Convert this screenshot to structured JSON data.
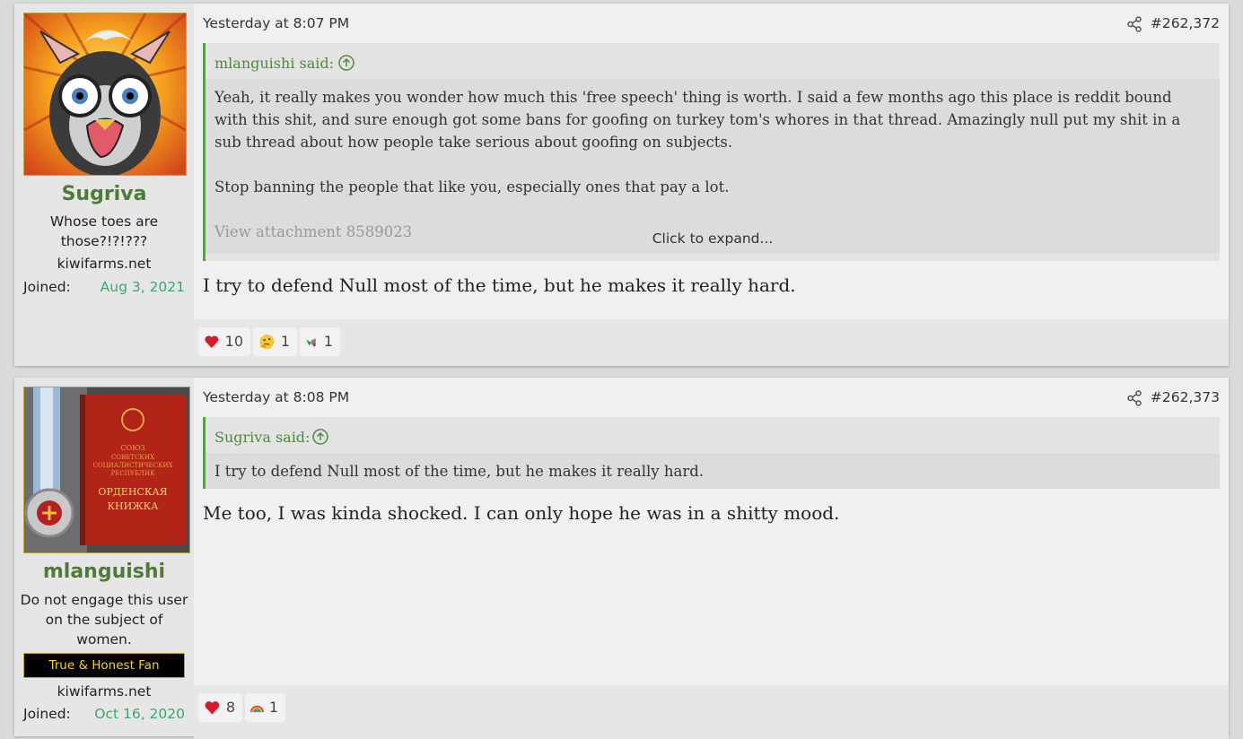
{
  "posts": [
    {
      "username": "Sugriva",
      "user_title": "Whose toes are those?!?!???",
      "site": "kiwifarms.net",
      "joined_label": "Joined:",
      "joined_date": "Aug 3, 2021",
      "date": "Yesterday at 8:07 PM",
      "post_number": "#262,372",
      "quote": {
        "author": "mlanguishi said:",
        "paragraphs": [
          "Yeah, it really makes you wonder how much this 'free speech' thing is worth. I said a few months ago this place is reddit bound with this shit, and sure enough got some bans for goofing on turkey tom's whores in that thread. Amazingly null put my shit in a sub thread about how people take serious about goofing on subjects.",
          "Stop banning the people that like you, especially ones that pay a lot.",
          "View attachment 8589023"
        ],
        "expand_label": "Click to expand..."
      },
      "message": "I try to defend Null most of the time, but he makes it really hard.",
      "reactions": [
        {
          "icon": "heart-icon",
          "count": "10"
        },
        {
          "icon": "thinking-face-icon",
          "count": "1"
        },
        {
          "icon": "megaphone-icon",
          "count": "1"
        }
      ]
    },
    {
      "username": "mlanguishi",
      "user_title": "Do not engage this user on the subject of women.",
      "banner": "True & Honest Fan",
      "site": "kiwifarms.net",
      "joined_label": "Joined:",
      "joined_date": "Oct 16, 2020",
      "date": "Yesterday at 8:08 PM",
      "post_number": "#262,373",
      "quote": {
        "author": "Sugriva said:",
        "paragraphs": [
          "I try to defend Null most of the time, but he makes it really hard."
        ]
      },
      "message": "Me too, I was kinda shocked. I can only hope he was in a shitty mood.",
      "reactions": [
        {
          "icon": "heart-icon",
          "count": "8"
        },
        {
          "icon": "rainbow-icon",
          "count": "1"
        }
      ]
    }
  ],
  "colors": {
    "username": "#4f7a3a",
    "joined_date": "#3fa66b",
    "quote_border": "#5c9c4c",
    "banner_text": "#f3d03e"
  }
}
